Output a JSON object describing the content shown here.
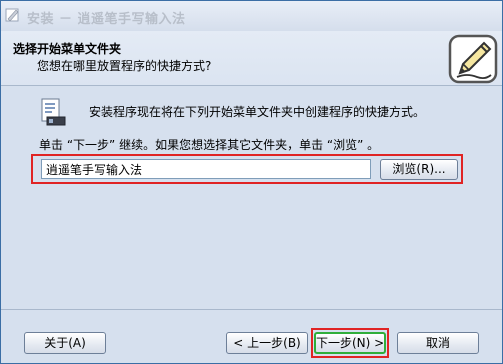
{
  "window": {
    "title": "安装 － 逍遥笔手写输入法"
  },
  "header": {
    "title": "选择开始菜单文件夹",
    "subtitle": "您想在哪里放置程序的快捷方式?"
  },
  "main": {
    "intro": "安装程序现在将在下列开始菜单文件夹中创建程序的快捷方式。",
    "hint": "单击 “下一步” 继续。如果您想选择其它文件夹，单击 “浏览” 。",
    "folder_value": "逍遥笔手写输入法",
    "browse_label": "浏览(R)..."
  },
  "footer": {
    "about_label": "关于(A)",
    "back_label": "< 上一步(B)",
    "next_label": "下一步(N) >",
    "cancel_label": "取消"
  },
  "colors": {
    "highlight_red": "#e02424",
    "focus_green": "#2fae3a",
    "window_background": "#d6e0ee"
  },
  "icons": {
    "title": "installer-icon",
    "header": "pencil-paper-icon",
    "program": "program-shortcut-icon"
  }
}
